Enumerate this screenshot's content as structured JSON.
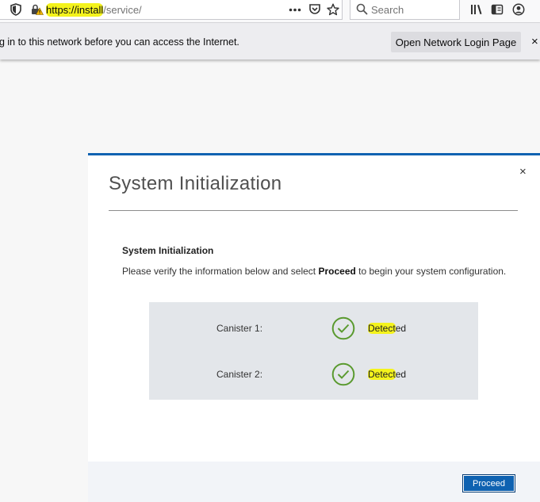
{
  "browser": {
    "url": {
      "scheme_host": "https://install",
      "path": "/service/"
    },
    "search": {
      "placeholder": "Search"
    },
    "icons": [
      "shield-icon",
      "lock-warning-icon",
      "more-actions-icon",
      "pocket-icon",
      "bookmark-star-icon",
      "search-icon",
      "library-icon",
      "reader-sidebar-icon",
      "account-icon"
    ]
  },
  "notification": {
    "message": "og in to this network before you can access the Internet.",
    "button_label": "Open Network Login Page",
    "close_glyph": "×"
  },
  "modal": {
    "title": "System Initialization",
    "close_glyph": "×",
    "section_heading": "System Initialization",
    "instructions": {
      "before": "Please verify the information below and select ",
      "bold": "Proceed",
      "after": " to begin your system configuration."
    },
    "rows": [
      {
        "label": "Canister 1:",
        "status_highlighted": "Detect",
        "status_rest": "ed",
        "icon": "check-circle-icon"
      },
      {
        "label": "Canister 2:",
        "status_highlighted": "Detect",
        "status_rest": "ed",
        "icon": "check-circle-icon"
      }
    ],
    "proceed_label": "Proceed"
  },
  "colors": {
    "accent_blue": "#0f62b1",
    "success_green": "#5a9a2f",
    "highlight_yellow": "#f4f31c"
  }
}
